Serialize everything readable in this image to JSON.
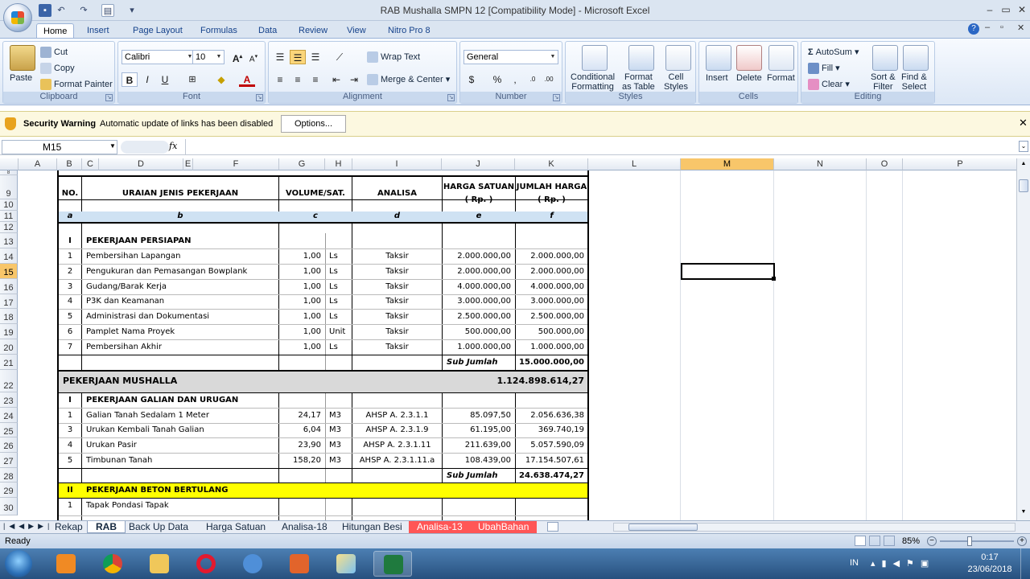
{
  "window": {
    "title": "RAB Mushalla SMPN 12  [Compatibility Mode] - Microsoft Excel"
  },
  "tabs": [
    "Home",
    "Insert",
    "Page Layout",
    "Formulas",
    "Data",
    "Review",
    "View",
    "Nitro Pro 8"
  ],
  "ribbon": {
    "clipboard": {
      "label": "Clipboard",
      "paste": "Paste",
      "cut": "Cut",
      "copy": "Copy",
      "format_painter": "Format Painter"
    },
    "font": {
      "label": "Font",
      "name": "Calibri",
      "size": "10"
    },
    "alignment": {
      "label": "Alignment",
      "wrap_text": "Wrap Text",
      "merge_center": "Merge & Center"
    },
    "number": {
      "label": "Number",
      "format": "General"
    },
    "styles": {
      "label": "Styles",
      "cond_fmt_1": "Conditional",
      "cond_fmt_2": "Formatting",
      "fmt_table_1": "Format",
      "fmt_table_2": "as Table",
      "cell_styles_1": "Cell",
      "cell_styles_2": "Styles"
    },
    "cells": {
      "label": "Cells",
      "insert": "Insert",
      "delete": "Delete",
      "format": "Format"
    },
    "editing": {
      "label": "Editing",
      "autosum": "AutoSum",
      "fill": "Fill",
      "clear": "Clear",
      "sort_1": "Sort &",
      "sort_2": "Filter",
      "find_1": "Find &",
      "find_2": "Select"
    }
  },
  "security": {
    "title": "Security Warning",
    "message": "Automatic update of links has been disabled",
    "options": "Options..."
  },
  "formula_bar": {
    "name_box": "M15",
    "fx": "fx",
    "content": ""
  },
  "columns": [
    "A",
    "B",
    "C",
    "D",
    "E",
    "F",
    "G",
    "H",
    "I",
    "J",
    "K",
    "L",
    "M",
    "N",
    "O",
    "P"
  ],
  "selected_column": "M",
  "selected_row": "15",
  "rows": [
    "8",
    "9",
    "10",
    "11",
    "12",
    "13",
    "14",
    "15",
    "16",
    "17",
    "18",
    "19",
    "20",
    "21",
    "22",
    "23",
    "24",
    "25",
    "26",
    "27",
    "28",
    "29",
    "30"
  ],
  "table": {
    "headers": {
      "no": "NO.",
      "uraian": "URAIAN JENIS PEKERJAAN",
      "volume": "VOLUME/SAT.",
      "analisa": "ANALISA",
      "harga_1": "HARGA SATUAN",
      "harga_2": "( Rp. )",
      "jumlah_1": "JUMLAH HARGA",
      "jumlah_2": "( Rp. )"
    },
    "subheaders": {
      "a": "a",
      "b": "b",
      "c": "c",
      "d": "d",
      "e": "e",
      "f": "f"
    },
    "section_1": {
      "no": "I",
      "title": "PEKERJAAN PERSIAPAN"
    },
    "items_1": [
      {
        "no": "1",
        "name": "Pembersihan Lapangan",
        "vol": "1,00",
        "sat": "Ls",
        "an": "Taksir",
        "harga": "2.000.000,00",
        "jumlah": "2.000.000,00"
      },
      {
        "no": "2",
        "name": "Pengukuran dan Pemasangan Bowplank",
        "vol": "1,00",
        "sat": "Ls",
        "an": "Taksir",
        "harga": "2.000.000,00",
        "jumlah": "2.000.000,00"
      },
      {
        "no": "3",
        "name": "Gudang/Barak Kerja",
        "vol": "1,00",
        "sat": "Ls",
        "an": "Taksir",
        "harga": "4.000.000,00",
        "jumlah": "4.000.000,00"
      },
      {
        "no": "4",
        "name": "P3K dan Keamanan",
        "vol": "1,00",
        "sat": "Ls",
        "an": "Taksir",
        "harga": "3.000.000,00",
        "jumlah": "3.000.000,00"
      },
      {
        "no": "5",
        "name": "Administrasi dan Dokumentasi",
        "vol": "1,00",
        "sat": "Ls",
        "an": "Taksir",
        "harga": "2.500.000,00",
        "jumlah": "2.500.000,00"
      },
      {
        "no": "6",
        "name": "Pamplet Nama Proyek",
        "vol": "1,00",
        "sat": "Unit",
        "an": "Taksir",
        "harga": "500.000,00",
        "jumlah": "500.000,00"
      },
      {
        "no": "7",
        "name": "Pembersihan Akhir",
        "vol": "1,00",
        "sat": "Ls",
        "an": "Taksir",
        "harga": "1.000.000,00",
        "jumlah": "1.000.000,00"
      }
    ],
    "subtotal_1": {
      "label": "Sub Jumlah",
      "value": "15.000.000,00"
    },
    "main_section": {
      "title": "PEKERJAAN MUSHALLA",
      "value": "1.124.898.614,27"
    },
    "section_2": {
      "no": "I",
      "title": "PEKERJAAN GALIAN DAN URUGAN"
    },
    "items_2": [
      {
        "no": "1",
        "name": "Galian Tanah Sedalam 1 Meter",
        "vol": "24,17",
        "sat": "M3",
        "an": "AHSP A. 2.3.1.1",
        "harga": "85.097,50",
        "jumlah": "2.056.636,38"
      },
      {
        "no": "3",
        "name": "Urukan Kembali Tanah Galian",
        "vol": "6,04",
        "sat": "M3",
        "an": "AHSP A. 2.3.1.9",
        "harga": "61.195,00",
        "jumlah": "369.740,19"
      },
      {
        "no": "4",
        "name": "Urukan Pasir",
        "vol": "23,90",
        "sat": "M3",
        "an": "AHSP A. 2.3.1.11",
        "harga": "211.639,00",
        "jumlah": "5.057.590,09"
      },
      {
        "no": "5",
        "name": "Timbunan Tanah",
        "vol": "158,20",
        "sat": "M3",
        "an": "AHSP A. 2.3.1.11.a",
        "harga": "108.439,00",
        "jumlah": "17.154.507,61"
      }
    ],
    "subtotal_2": {
      "label": "Sub Jumlah",
      "value": "24.638.474,27"
    },
    "section_3": {
      "no": "II",
      "title": "PEKERJAAN BETON BERTULANG"
    },
    "item_3": {
      "no": "1",
      "name": "Tapak Pondasi Tapak"
    }
  },
  "sheets": [
    "Rekap",
    "RAB",
    "Back Up Data",
    "Harga Satuan",
    "Analisa-18",
    "Hitungan Besi",
    "Analisa-13",
    "UbahBahan"
  ],
  "active_sheet": "RAB",
  "status": {
    "ready": "Ready",
    "zoom": "85%"
  },
  "taskbar": {
    "lang": "IN",
    "time": "0:17",
    "date": "23/06/2018"
  },
  "colors": {
    "yellow": "#ffff00",
    "gray_section": "#d9d9d9",
    "subheader": "#cfe2f3",
    "selected": "#f8c66a",
    "red_tab": "#ff5656"
  }
}
